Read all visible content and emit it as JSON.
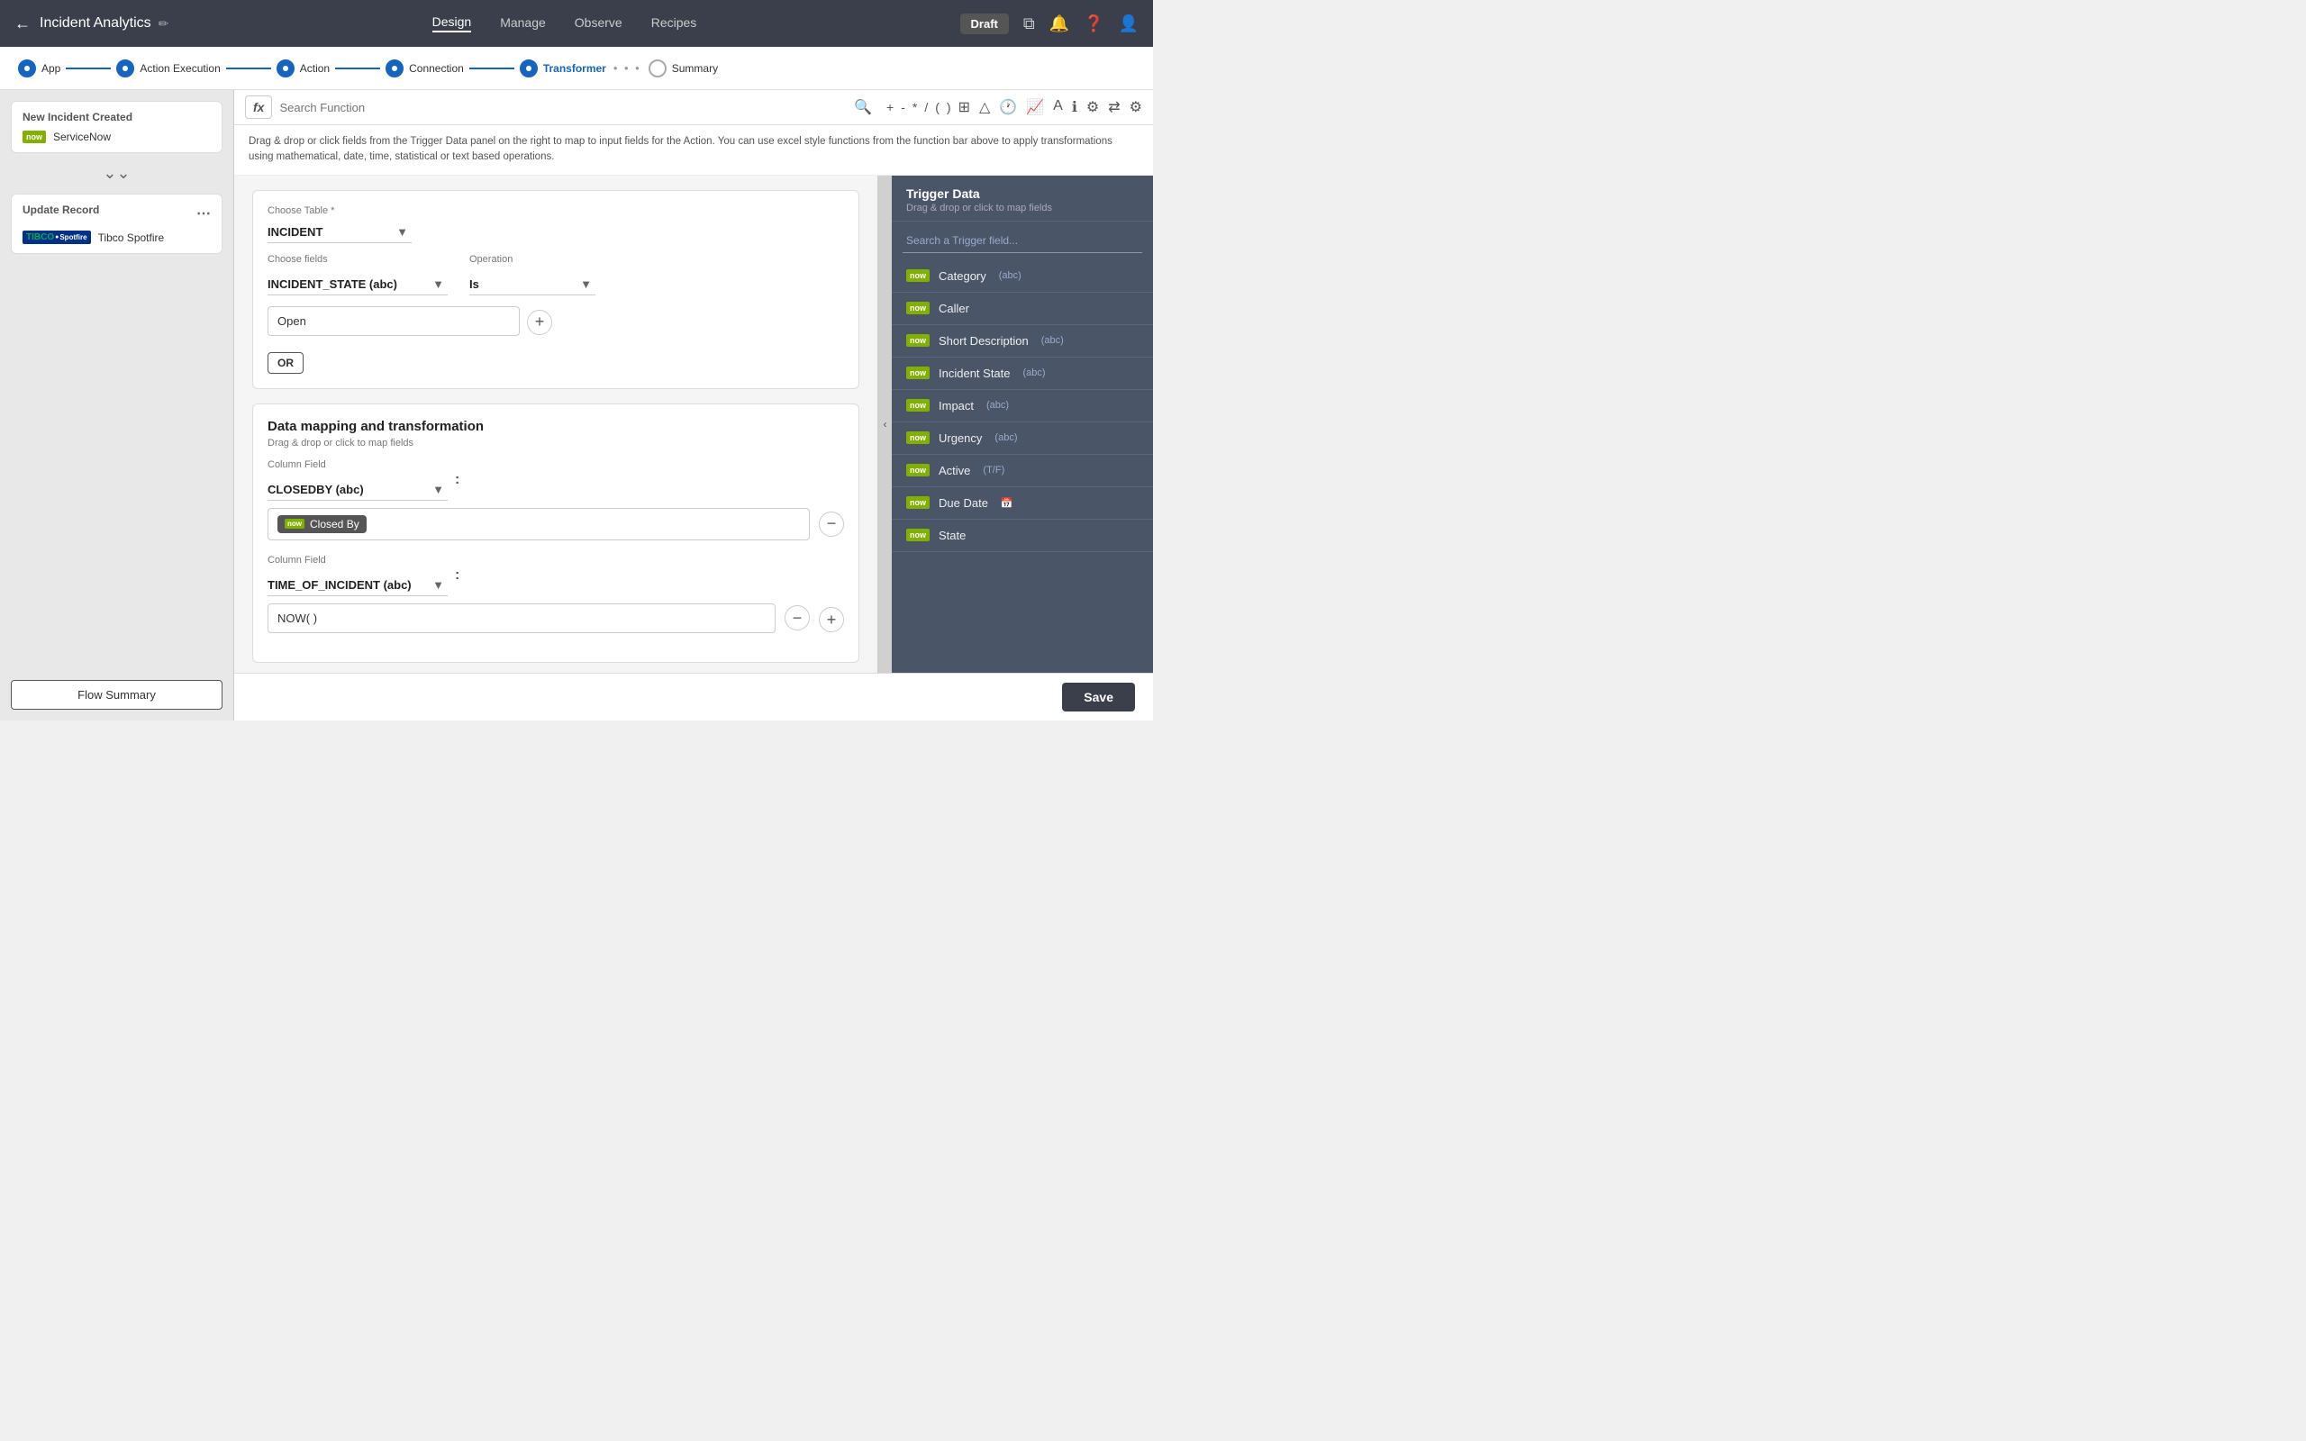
{
  "app": {
    "title": "Incident Analytics",
    "status": "Draft"
  },
  "nav": {
    "tabs": [
      "Design",
      "Manage",
      "Observe",
      "Recipes"
    ],
    "active_tab": "Design"
  },
  "steps": [
    {
      "label": "App",
      "state": "filled"
    },
    {
      "label": "Action Execution",
      "state": "filled"
    },
    {
      "label": "Action",
      "state": "filled"
    },
    {
      "label": "Connection",
      "state": "filled"
    },
    {
      "label": "Transformer",
      "state": "filled"
    },
    {
      "label": "Summary",
      "state": "empty"
    }
  ],
  "sidebar": {
    "trigger_card": {
      "title": "New Incident Created",
      "item_name": "ServiceNow"
    },
    "action_card": {
      "title": "Update Record",
      "item_name": "Tibco Spotfire"
    },
    "flow_summary_label": "Flow Summary"
  },
  "formula_bar": {
    "fx_label": "fx",
    "placeholder": "Search Function",
    "ops": [
      "+",
      "-",
      "*",
      "/",
      "(",
      ")"
    ]
  },
  "instruction": {
    "text": "Drag & drop or click fields from the Trigger Data panel on the right to map to input fields for the Action. You can use excel style functions from the function bar above to apply transformations using mathematical, date, time, statistical or text based operations."
  },
  "filter": {
    "choose_table_label": "Choose Table *",
    "table_value": "INCIDENT",
    "choose_fields_label": "Choose fields",
    "fields_value": "INCIDENT_STATE (abc)",
    "operation_label": "Operation",
    "operation_value": "Is",
    "value": "Open",
    "or_label": "OR"
  },
  "mapping": {
    "title": "Data mapping and transformation",
    "subtitle": "Drag & drop or click to map fields",
    "rows": [
      {
        "column_field_label": "Column Field",
        "column_value": "CLOSEDBY (abc)",
        "field_tag": "Closed By"
      },
      {
        "column_field_label": "Column Field",
        "column_value": "TIME_OF_INCIDENT (abc)",
        "field_value": "NOW( )"
      }
    ]
  },
  "trigger_panel": {
    "title": "Trigger Data",
    "subtitle": "Drag & drop or click to map fields",
    "search_placeholder": "Search a Trigger field...",
    "items": [
      {
        "name": "Category",
        "type": "(abc)"
      },
      {
        "name": "Caller",
        "type": ""
      },
      {
        "name": "Short Description",
        "type": "(abc)"
      },
      {
        "name": "Incident State",
        "type": "(abc)"
      },
      {
        "name": "Impact",
        "type": "(abc)"
      },
      {
        "name": "Urgency",
        "type": "(abc)"
      },
      {
        "name": "Active",
        "type": "(T/F)"
      },
      {
        "name": "Due Date",
        "type": "📅"
      },
      {
        "name": "State",
        "type": ""
      }
    ]
  },
  "bottom_bar": {
    "save_label": "Save"
  }
}
